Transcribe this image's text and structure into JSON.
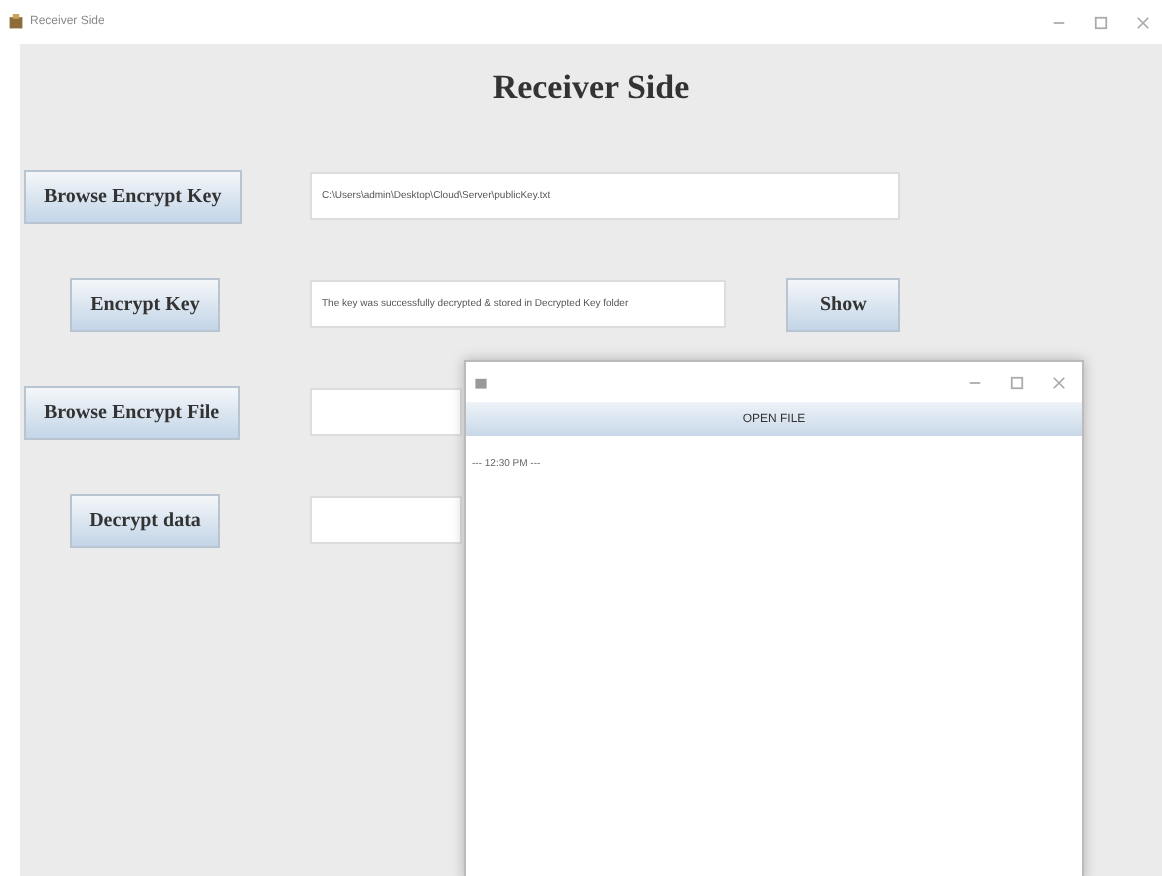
{
  "window": {
    "title": "Receiver Side"
  },
  "heading": "Receiver Side",
  "rows": [
    {
      "button": "Browse Encrypt Key",
      "value": "C:\\Users\\admin\\Desktop\\Cloud\\Server\\publicKey.txt"
    },
    {
      "button": "Encrypt Key",
      "value": "The key was successfully decrypted & stored in Decrypted Key folder",
      "extra": "Show"
    },
    {
      "button": "Browse Encrypt File"
    },
    {
      "button": "Decrypt data"
    }
  ],
  "popup": {
    "header_button": "OPEN FILE",
    "text": "--- 12:30 PM ---"
  }
}
